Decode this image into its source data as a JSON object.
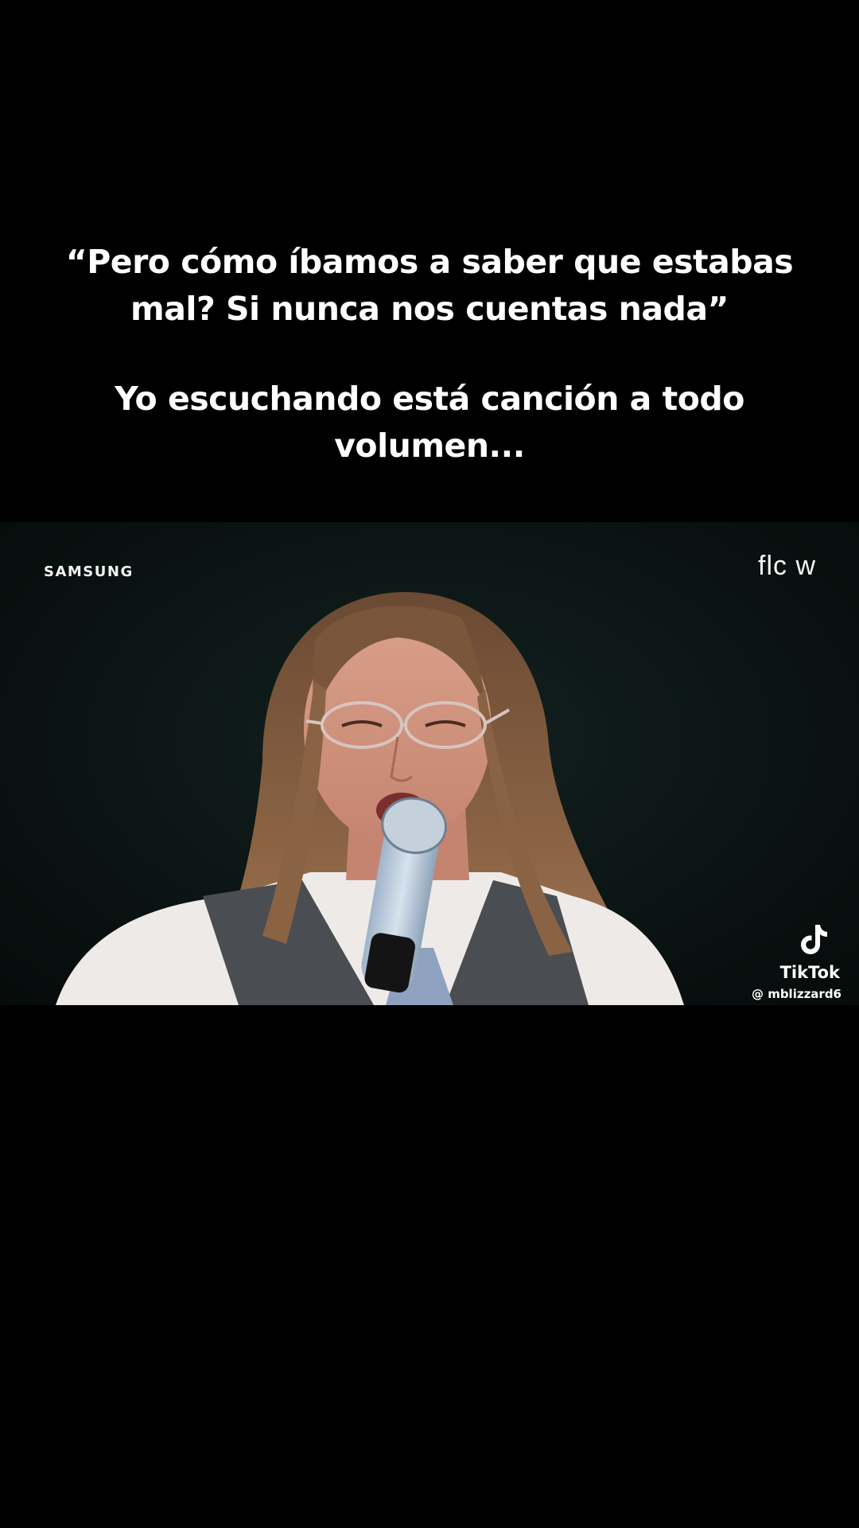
{
  "caption": {
    "quote_line1": "“Pero cómo íbamos a saber que estabas",
    "quote_line2": "mal? Si nunca nos cuentas nada”",
    "reaction_line1": "Yo escuchando está canción a todo",
    "reaction_line2": "volumen..."
  },
  "video": {
    "brand_left": "SAMSUNG",
    "brand_right": "flc w",
    "watermark": {
      "icon": "tiktok-icon",
      "name": "TikTok",
      "user": "@ mblizzard6"
    }
  },
  "colors": {
    "background": "#000000",
    "text": "#ffffff",
    "video_bg": "#0b1514"
  }
}
